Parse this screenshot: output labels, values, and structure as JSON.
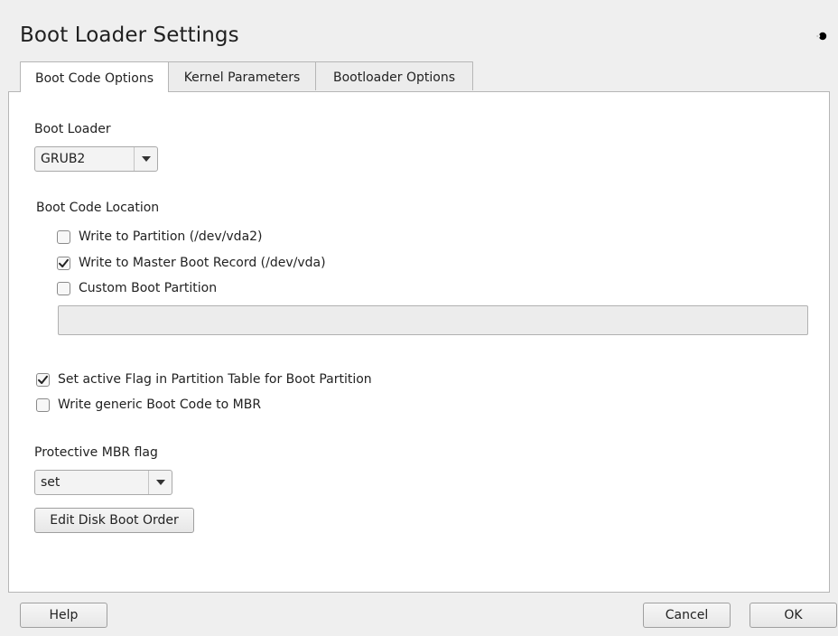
{
  "window": {
    "title": "Boot Loader Settings"
  },
  "tabs": [
    {
      "label": "Boot Code Options",
      "active": true
    },
    {
      "label": "Kernel Parameters",
      "active": false
    },
    {
      "label": "Bootloader Options",
      "active": false
    }
  ],
  "boot_loader": {
    "label": "Boot Loader",
    "value": "GRUB2"
  },
  "boot_code_location": {
    "label": "Boot Code Location",
    "options": [
      {
        "label": "Write to Partition (/dev/vda2)",
        "checked": false
      },
      {
        "label": "Write to Master Boot Record (/dev/vda)",
        "checked": true
      },
      {
        "label": "Custom Boot Partition",
        "checked": false
      }
    ],
    "custom_partition_value": ""
  },
  "flags": [
    {
      "label": "Set active Flag in Partition Table for Boot Partition",
      "checked": true
    },
    {
      "label": "Write generic Boot Code to MBR",
      "checked": false
    }
  ],
  "protective_mbr": {
    "label": "Protective MBR flag",
    "value": "set"
  },
  "buttons": {
    "edit_disk_boot_order": "Edit Disk Boot Order",
    "help": "Help",
    "cancel": "Cancel",
    "ok": "OK"
  },
  "icons": {
    "corner": "moon-icon",
    "check": "checkmark-icon",
    "dropdown": "dropdown-arrow-icon"
  },
  "colors": {
    "background": "#efefef",
    "panel": "#ffffff",
    "border": "#b6b6b6",
    "text": "#222222"
  }
}
